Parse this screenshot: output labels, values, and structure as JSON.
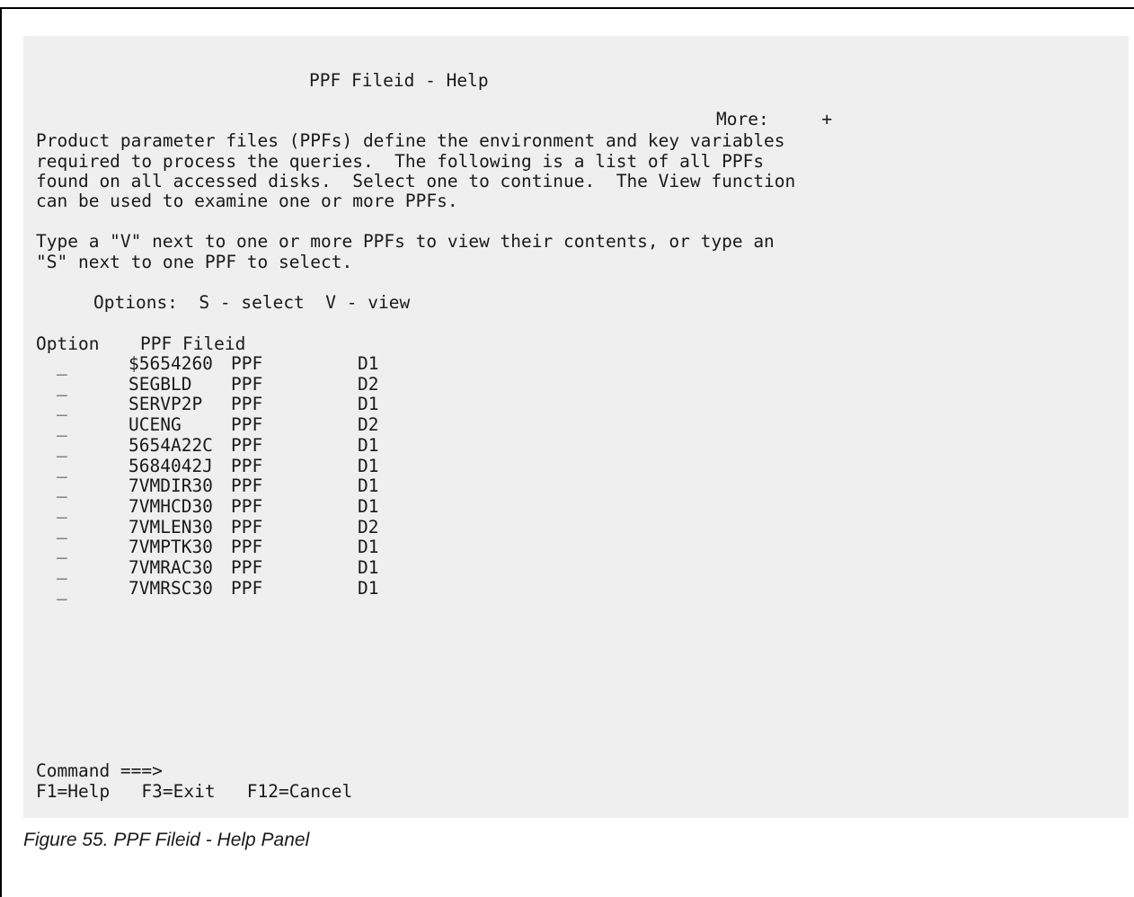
{
  "panel": {
    "title": "PPF Fileid - Help",
    "more_indicator": "More:     +",
    "description": [
      "Product parameter files (PPFs) define the environment and key variables",
      "required to process the queries.  The following is a list of all PPFs",
      "found on all accessed disks.  Select one to continue.  The View function",
      "can be used to examine one or more PPFs."
    ],
    "instructions": [
      "Type a \"V\" next to one or more PPFs to view their contents, or type an",
      "\"S\" next to one PPF to select."
    ],
    "options_line": "Options:  S - select  V - view",
    "column_headers": {
      "option": "Option",
      "fileid": "PPF Fileid"
    },
    "rows": [
      {
        "option": "_",
        "fn": "$5654260",
        "ft": "PPF",
        "fm": "D1"
      },
      {
        "option": "_",
        "fn": "SEGBLD",
        "ft": "PPF",
        "fm": "D2"
      },
      {
        "option": "_",
        "fn": "SERVP2P",
        "ft": "PPF",
        "fm": "D1"
      },
      {
        "option": "_",
        "fn": "UCENG",
        "ft": "PPF",
        "fm": "D2"
      },
      {
        "option": "_",
        "fn": "5654A22C",
        "ft": "PPF",
        "fm": "D1"
      },
      {
        "option": "_",
        "fn": "5684042J",
        "ft": "PPF",
        "fm": "D1"
      },
      {
        "option": "_",
        "fn": "7VMDIR30",
        "ft": "PPF",
        "fm": "D1"
      },
      {
        "option": "_",
        "fn": "7VMHCD30",
        "ft": "PPF",
        "fm": "D1"
      },
      {
        "option": "_",
        "fn": "7VMLEN30",
        "ft": "PPF",
        "fm": "D2"
      },
      {
        "option": "_",
        "fn": "7VMPTK30",
        "ft": "PPF",
        "fm": "D1"
      },
      {
        "option": "_",
        "fn": "7VMRAC30",
        "ft": "PPF",
        "fm": "D1"
      },
      {
        "option": "_",
        "fn": "7VMRSC30",
        "ft": "PPF",
        "fm": "D1"
      }
    ],
    "command_prompt": "Command ===>",
    "function_keys": "F1=Help   F3=Exit   F12=Cancel"
  },
  "caption": "Figure 55. PPF Fileid - Help Panel"
}
